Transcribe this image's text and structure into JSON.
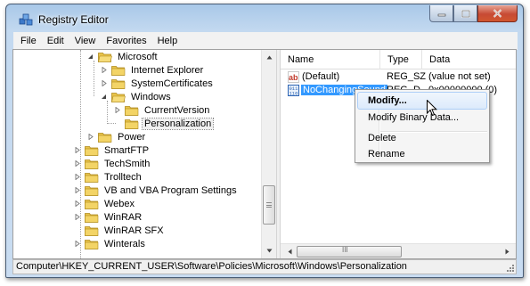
{
  "window": {
    "title": "Registry Editor",
    "app_icon": "registry-editor-icon"
  },
  "menu": [
    "File",
    "Edit",
    "View",
    "Favorites",
    "Help"
  ],
  "tree": {
    "nodes": [
      {
        "label": "Microsoft",
        "expanded": true
      },
      {
        "label": "Internet Explorer",
        "expanded": false
      },
      {
        "label": "SystemCertificates",
        "expanded": false
      },
      {
        "label": "Windows",
        "expanded": true
      },
      {
        "label": "CurrentVersion",
        "expanded": false
      },
      {
        "label": "Personalization",
        "selected": true
      },
      {
        "label": "Power",
        "expanded": false
      },
      {
        "label": "SmartFTP",
        "expanded": false
      },
      {
        "label": "TechSmith",
        "expanded": false
      },
      {
        "label": "Trolltech",
        "expanded": false
      },
      {
        "label": "VB and VBA Program Settings",
        "expanded": false
      },
      {
        "label": "Webex",
        "expanded": false
      },
      {
        "label": "WinRAR",
        "expanded": false
      },
      {
        "label": "WinRAR SFX",
        "expanded": false
      },
      {
        "label": "Winterals",
        "expanded": false
      }
    ]
  },
  "list": {
    "columns": [
      "Name",
      "Type",
      "Data"
    ],
    "rows": [
      {
        "name": "(Default)",
        "type": "REG_SZ",
        "data": "(value not set)",
        "icon": "string-value-icon"
      },
      {
        "name": "NoChangingSound",
        "type": "REG_D",
        "data": "0x00000000 (0)",
        "icon": "dword-value-icon",
        "selected": true
      }
    ],
    "hscroll_glyph": "III"
  },
  "context_menu": {
    "items": [
      "Modify...",
      "Modify Binary Data...",
      "Delete",
      "Rename"
    ],
    "highlighted": "Modify..."
  },
  "status": {
    "path": "Computer\\HKEY_CURRENT_USER\\Software\\Policies\\Microsoft\\Windows\\Personalization"
  },
  "colors": {
    "selection": "#3399ff",
    "folder": "#e8c34a",
    "close_button": "#c74a34"
  }
}
